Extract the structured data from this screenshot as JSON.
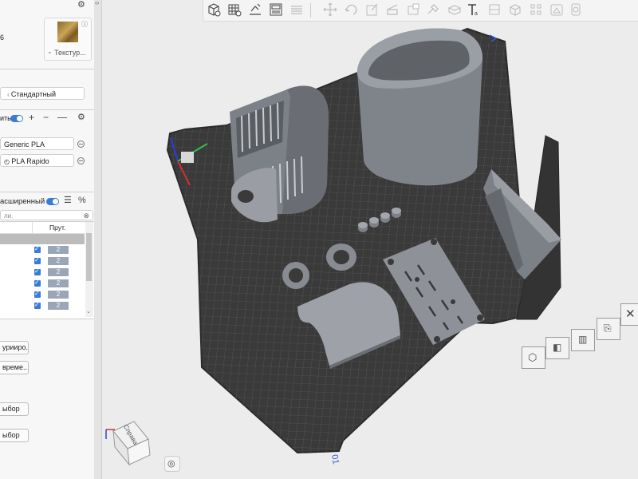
{
  "sidebar": {
    "printer_fragment": "6",
    "texture_label": "Текстур...",
    "preset_label": "Стандартный",
    "filament_header": "ить",
    "filaments": [
      "Generic PLA",
      "PLA Rapido"
    ],
    "mode_label": "асширенный",
    "search_placeholder": "ли.",
    "column_header": "Прут.",
    "rows": [
      "2",
      "2",
      "2",
      "2",
      "2",
      "2"
    ],
    "buttons": [
      "урииро...",
      "време...",
      "ыбор",
      "ыбор"
    ]
  },
  "viewport": {
    "cube_label": "Справа",
    "axis_label": "01"
  },
  "colors": {
    "accent": "#3a7bd5",
    "bed": "#3a3a3a",
    "model": "#8e9299"
  },
  "icons": [
    "info-icon",
    "gear-icon",
    "plus-icon",
    "minus-icon",
    "list-icon",
    "percent-icon",
    "clear-icon",
    "chevron-down-icon",
    "collapse-icon",
    "add-cube-icon",
    "grid-icon",
    "arrange-icon",
    "layout-icon",
    "layers-icon",
    "move-icon",
    "rotate-icon",
    "scale-icon",
    "cut-icon",
    "paint-icon",
    "seam-icon",
    "text-icon",
    "split-icon",
    "assemble-icon",
    "view-icon",
    "close-icon",
    "fit-view-icon"
  ]
}
